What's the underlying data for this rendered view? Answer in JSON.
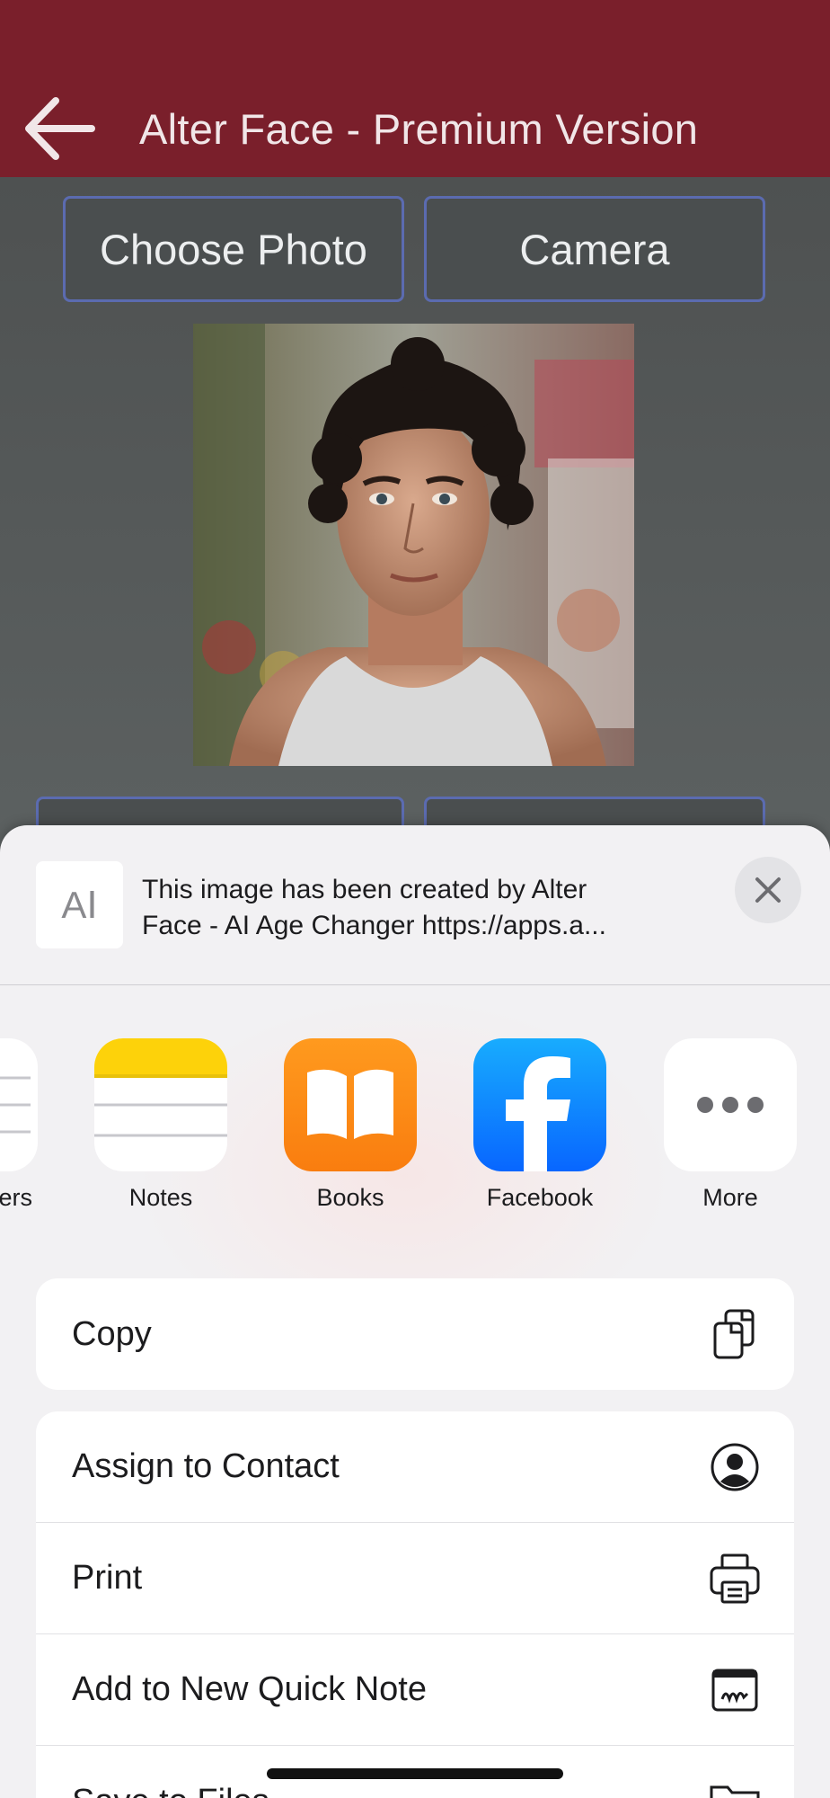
{
  "header": {
    "title": "Alter Face - Premium Version",
    "back_icon": "back-arrow-icon"
  },
  "app_buttons": {
    "choose_photo": "Choose Photo",
    "camera": "Camera"
  },
  "share_sheet": {
    "preview_text_line1": "This image has been created by Alter",
    "preview_text_line2": "Face - AI Age Changer https://apps.a...",
    "preview_thumb": "A",
    "close_icon": "close-icon",
    "apps": [
      {
        "label": "ers",
        "icon": "reminders-icon"
      },
      {
        "label": "Notes",
        "icon": "notes-icon"
      },
      {
        "label": "Books",
        "icon": "books-icon"
      },
      {
        "label": "Facebook",
        "icon": "facebook-icon"
      },
      {
        "label": "More",
        "icon": "more-icon"
      }
    ],
    "actions_group1": [
      {
        "label": "Copy",
        "icon": "copy-icon"
      }
    ],
    "actions_group2": [
      {
        "label": "Assign to Contact",
        "icon": "contact-icon"
      },
      {
        "label": "Print",
        "icon": "printer-icon"
      },
      {
        "label": "Add to New Quick Note",
        "icon": "quick-note-icon"
      },
      {
        "label": "Save to Files",
        "icon": "folder-icon"
      }
    ]
  },
  "colors": {
    "header_bg": "#7a1f2b",
    "button_border": "#5b6bb0",
    "sheet_bg": "#f2f1f3",
    "facebook_blue": "#1877f2"
  }
}
